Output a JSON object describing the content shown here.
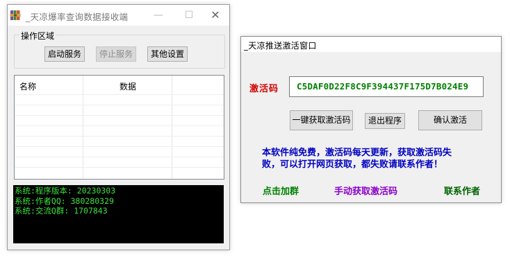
{
  "server_window": {
    "title": "_天凉爆率查询数据接收端",
    "icon": "winrar-books-icon",
    "controls": {
      "minimize": "—",
      "maximize": "☐",
      "close": "✕"
    },
    "group_title": "操作区域",
    "buttons": {
      "start": "启动服务",
      "stop": "停止服务",
      "other": "其他设置"
    },
    "list": {
      "columns": [
        "名称",
        "数据"
      ],
      "rows": []
    },
    "console_lines": [
      "系统:程序版本: 20230303",
      "系统:作者QQ: 380280329",
      "系统:交流Q群: 1707843"
    ],
    "colors": {
      "console_bg": "#000000",
      "console_text": "#3fe03f"
    }
  },
  "activation_window": {
    "title": "_天凉推送激活窗口",
    "code_label": "激活码",
    "code_value": "C5DAF0D22F8C9F394437F175D7B024E9",
    "buttons": {
      "get_code": "一键获取激活码",
      "exit": "退出程序",
      "confirm": "确认激活"
    },
    "notice_lines": [
      "本软件纯免费，激活码每天更新，获取激活码失",
      "败，可以打开网页获取，都失败请联系作者！"
    ],
    "links": {
      "join_group": "点击加群",
      "manual_get": "手动获取激活码",
      "contact_author": "联系作者"
    },
    "colors": {
      "label": "#d40000",
      "code": "#008000",
      "notice": "#0000c0",
      "join": "#008000",
      "manual": "#8a00c8",
      "contact": "#006400"
    }
  }
}
